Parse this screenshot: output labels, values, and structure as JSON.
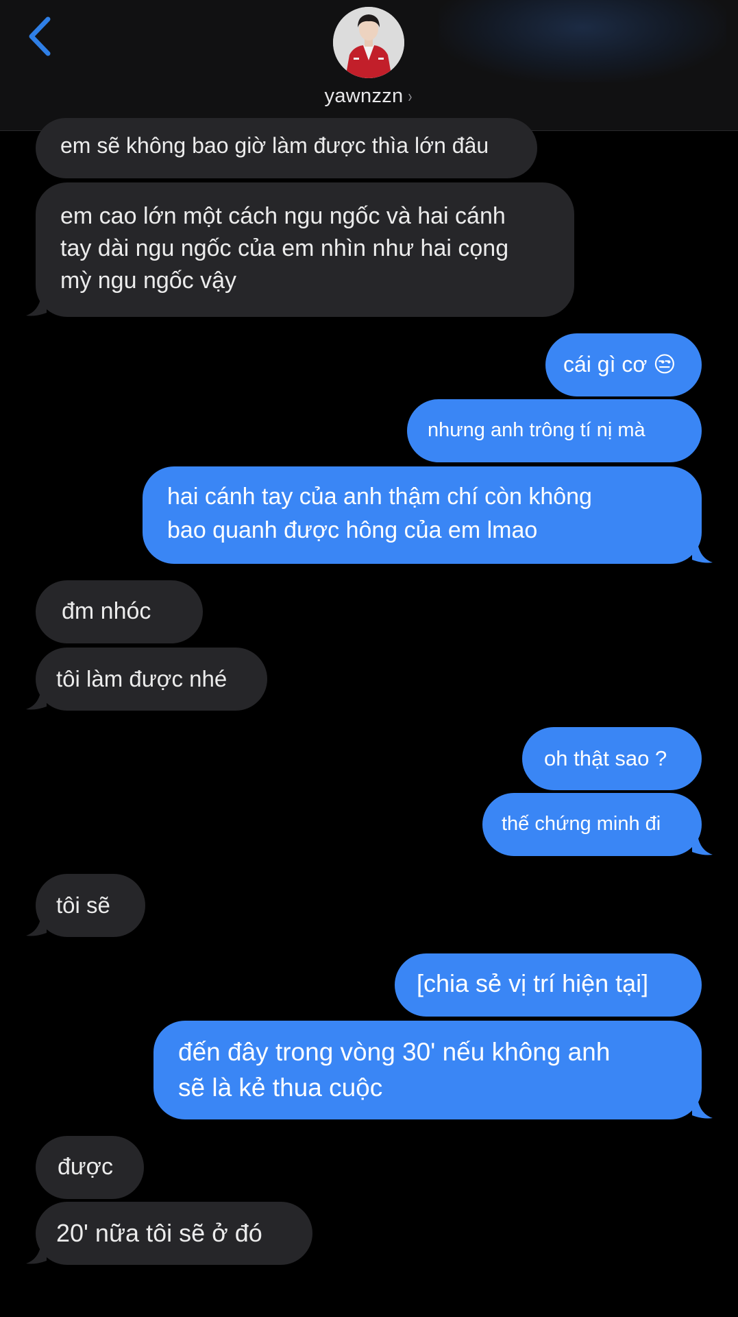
{
  "header": {
    "contact_name": "yawnzzn",
    "chevron": "›",
    "back_icon": "chevron-left-icon",
    "accent": "#2f7fe6"
  },
  "colors": {
    "incoming_bubble": "#262629",
    "outgoing_bubble": "#3a86f5",
    "background": "#000000"
  },
  "messages": [
    {
      "from": "them",
      "text": "em sẽ không bao giờ làm được thìa lớn đâu"
    },
    {
      "from": "them",
      "text": "em cao lớn một cách ngu ngốc và hai cánh\ntay dài ngu ngốc của em nhìn như hai cọng\nmỳ ngu ngốc vậy"
    },
    {
      "from": "me",
      "text": "cái gì cơ 😒"
    },
    {
      "from": "me",
      "text": "nhưng anh trông tí nị mà"
    },
    {
      "from": "me",
      "text": "hai cánh tay của anh thậm chí còn không\nbao quanh được hông của em lmao"
    },
    {
      "from": "them",
      "text": "đm nhóc"
    },
    {
      "from": "them",
      "text": "tôi làm được nhé"
    },
    {
      "from": "me",
      "text": "oh thật sao ?"
    },
    {
      "from": "me",
      "text": "thế chứng minh đi"
    },
    {
      "from": "them",
      "text": "tôi sẽ"
    },
    {
      "from": "me",
      "text": "[chia sẻ vị trí hiện tại]"
    },
    {
      "from": "me",
      "text": "đến đây trong vòng 30' nếu không anh\nsẽ là kẻ thua cuộc"
    },
    {
      "from": "them",
      "text": "được"
    },
    {
      "from": "them",
      "text": "20' nữa tôi sẽ ở đó"
    }
  ]
}
